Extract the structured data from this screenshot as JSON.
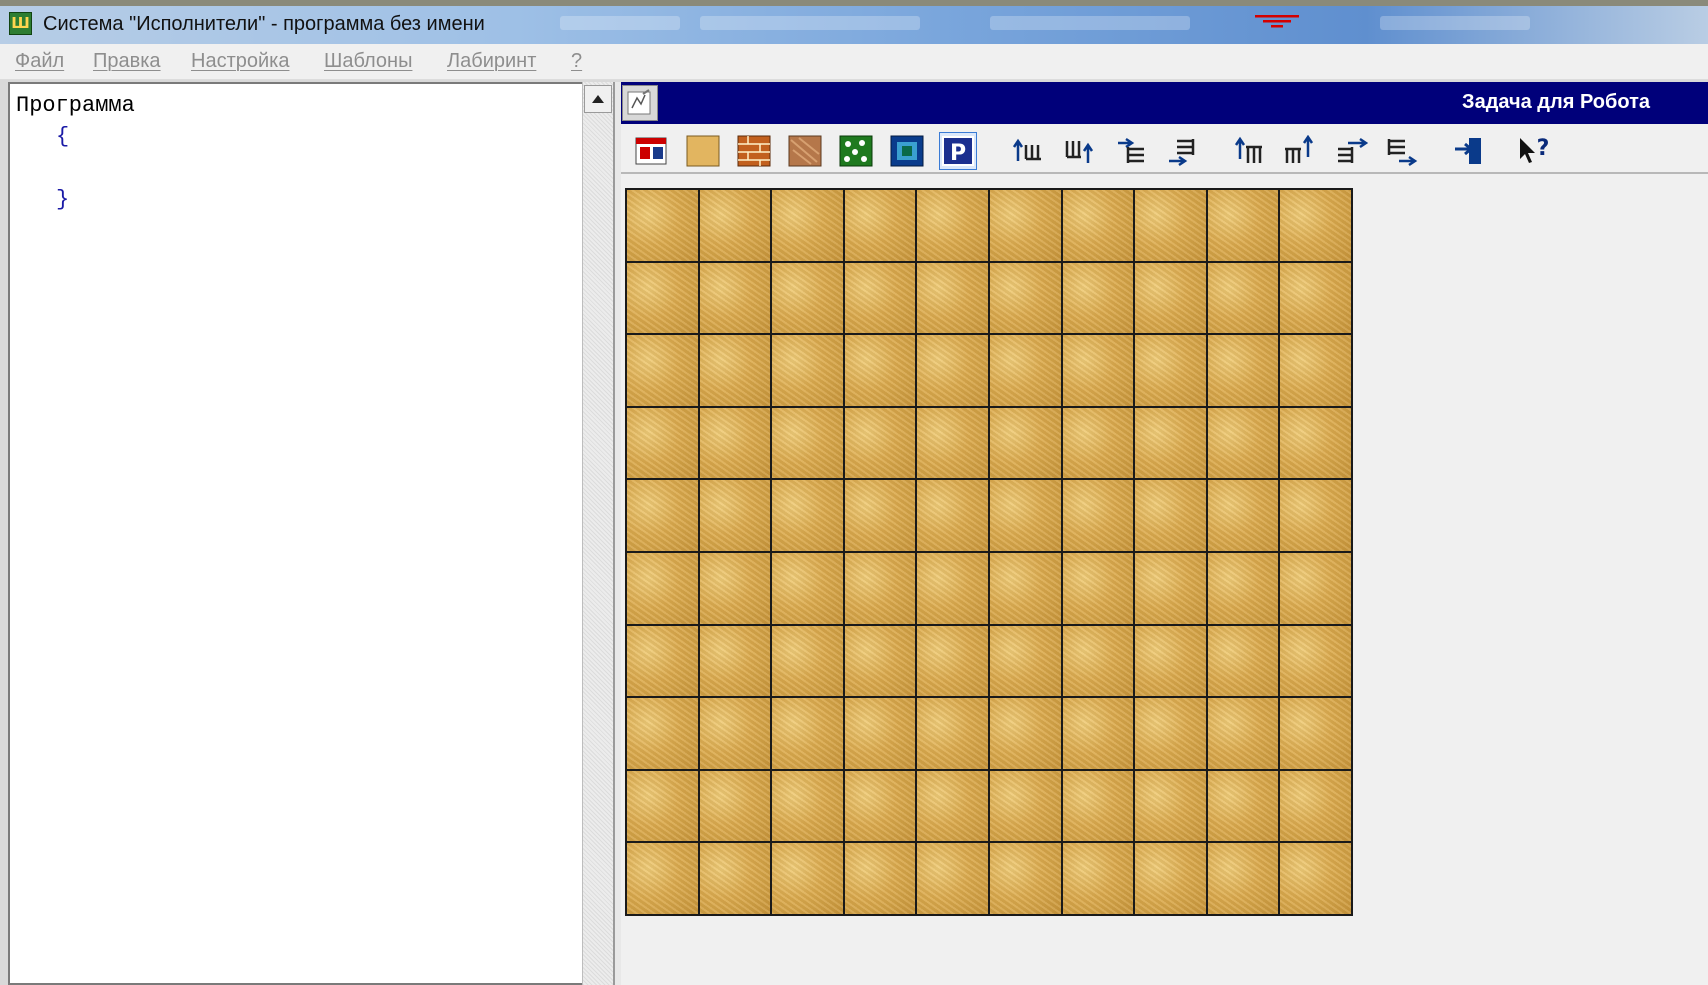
{
  "window": {
    "title": "Система \"Исполнители\" - программа без имени",
    "app_icon": "robot-app-icon"
  },
  "menu": {
    "items": [
      {
        "label": "Файл"
      },
      {
        "label": "Правка"
      },
      {
        "label": "Настройка"
      },
      {
        "label": "Шаблоны"
      },
      {
        "label": "Лабиринт"
      },
      {
        "label": "?"
      }
    ]
  },
  "editor": {
    "lines": [
      "Программа",
      "{",
      "}"
    ]
  },
  "robot_panel": {
    "title": "Задача для Робота",
    "toolbar": [
      {
        "icon": "open-task-icon"
      },
      {
        "icon": "empty-cell-icon"
      },
      {
        "icon": "wall-icon"
      },
      {
        "icon": "painted-cell-icon"
      },
      {
        "icon": "flowers-cell-icon"
      },
      {
        "icon": "portal-cell-icon"
      },
      {
        "icon": "parking-icon",
        "selected": true
      },
      {
        "icon": "add-top-row-icon"
      },
      {
        "icon": "remove-top-row-icon"
      },
      {
        "icon": "add-left-column-icon"
      },
      {
        "icon": "remove-left-column-icon"
      },
      {
        "icon": "add-bottom-row-icon"
      },
      {
        "icon": "remove-bottom-row-icon"
      },
      {
        "icon": "add-right-column-icon"
      },
      {
        "icon": "remove-right-column-icon"
      },
      {
        "icon": "exit-icon"
      },
      {
        "icon": "help-icon"
      }
    ],
    "field": {
      "rows": 10,
      "cols": 10,
      "cell_type": "empty"
    }
  },
  "colors": {
    "panel_header": "#00007a",
    "cell": "#dcab4e",
    "grid_line": "#1a1a1a"
  }
}
